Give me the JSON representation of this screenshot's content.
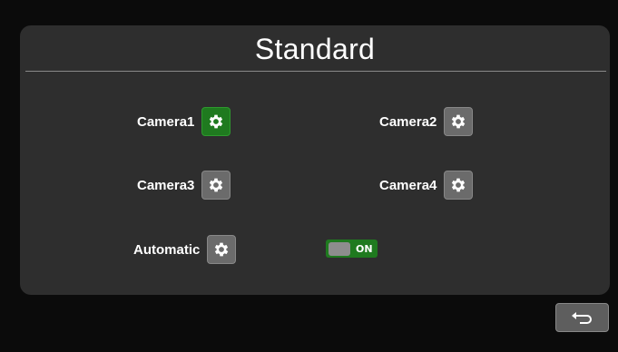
{
  "header": {
    "title": "Standard"
  },
  "cameras": [
    {
      "label": "Camera1",
      "active": true
    },
    {
      "label": "Camera2",
      "active": false
    },
    {
      "label": "Camera3",
      "active": false
    },
    {
      "label": "Camera4",
      "active": false
    }
  ],
  "automatic": {
    "label": "Automatic"
  },
  "toggle": {
    "state_label": "ON"
  },
  "icons": {
    "settings": "gear-icon",
    "back": "back-arrow-icon"
  },
  "colors": {
    "active": "#1f7a1f",
    "button": "#6b6b6b",
    "panel": "#2e2e2e"
  }
}
